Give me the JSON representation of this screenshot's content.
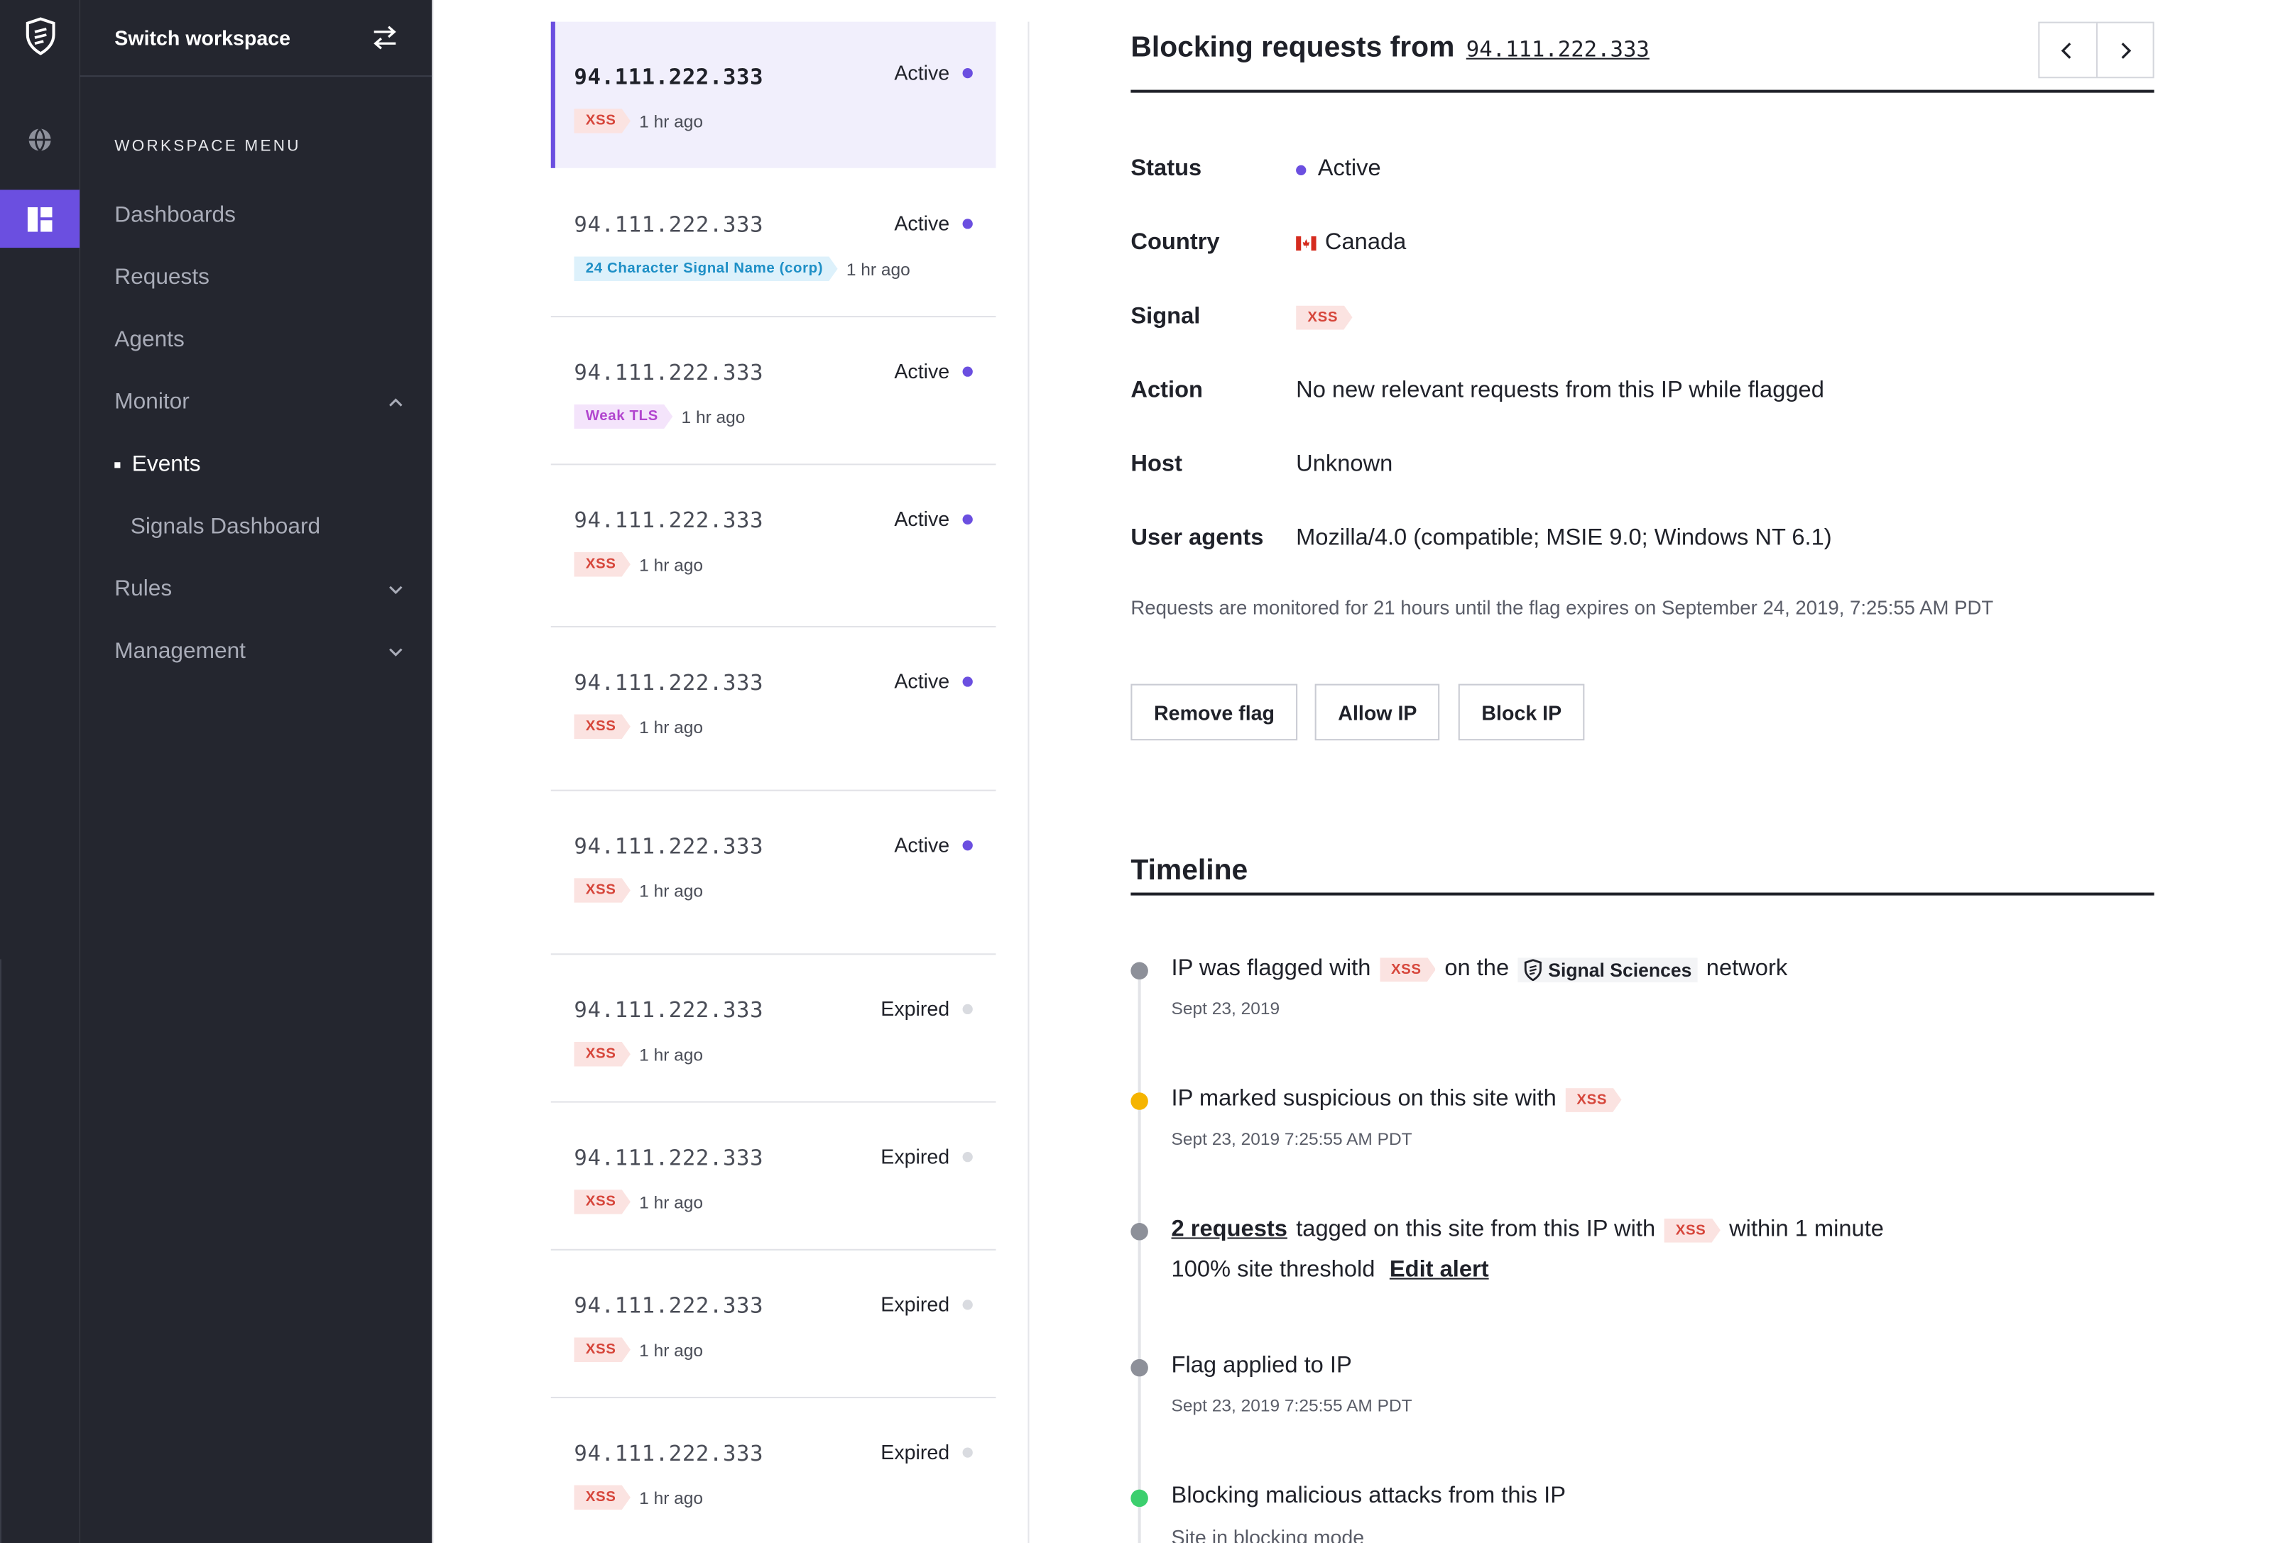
{
  "sidebar": {
    "switch_label": "Switch workspace",
    "menu_label": "WORKSPACE MENU",
    "items": [
      {
        "label": "Dashboards"
      },
      {
        "label": "Requests"
      },
      {
        "label": "Agents"
      },
      {
        "label": "Monitor"
      },
      {
        "label": "Events"
      },
      {
        "label": "Signals Dashboard"
      },
      {
        "label": "Rules"
      },
      {
        "label": "Management"
      }
    ]
  },
  "list": {
    "cards": [
      {
        "ip": "94.111.222.333",
        "state": "Active",
        "tag": "XSS",
        "time": "1 hr ago"
      },
      {
        "ip": "94.111.222.333",
        "state": "Active",
        "tag": "24 Character Signal Name (corp)",
        "time": "1 hr ago"
      },
      {
        "ip": "94.111.222.333",
        "state": "Active",
        "tag": "Weak TLS",
        "time": "1 hr ago"
      },
      {
        "ip": "94.111.222.333",
        "state": "Active",
        "tag": "XSS",
        "time": "1 hr ago"
      },
      {
        "ip": "94.111.222.333",
        "state": "Active",
        "tag": "XSS",
        "time": "1 hr ago"
      },
      {
        "ip": "94.111.222.333",
        "state": "Active",
        "tag": "XSS",
        "time": "1 hr ago"
      },
      {
        "ip": "94.111.222.333",
        "state": "Expired",
        "tag": "XSS",
        "time": "1 hr ago"
      },
      {
        "ip": "94.111.222.333",
        "state": "Expired",
        "tag": "XSS",
        "time": "1 hr ago"
      },
      {
        "ip": "94.111.222.333",
        "state": "Expired",
        "tag": "XSS",
        "time": "1 hr ago"
      },
      {
        "ip": "94.111.222.333",
        "state": "Expired",
        "tag": "XSS",
        "time": "1 hr ago"
      }
    ]
  },
  "detail": {
    "title": "Blocking requests from",
    "ip": "94.111.222.333",
    "rows": {
      "status_label": "Status",
      "status_value": "Active",
      "country_label": "Country",
      "country_value": "Canada",
      "signal_label": "Signal",
      "signal_value": "XSS",
      "action_label": "Action",
      "action_value": "No new relevant requests from this IP while flagged",
      "host_label": "Host",
      "host_value": "Unknown",
      "ua_label": "User agents",
      "ua_value": "Mozilla/4.0 (compatible; MSIE 9.0; Windows NT 6.1)"
    },
    "note": "Requests are monitored for 21 hours until the flag expires on September 24, 2019, 7:25:55 AM PDT",
    "buttons": {
      "remove": "Remove flag",
      "allow": "Allow IP",
      "block": "Block IP"
    }
  },
  "timeline": {
    "title": "Timeline",
    "items": [
      {
        "a": "IP was flagged with",
        "tag": "XSS",
        "b": "on the",
        "brand": "Signal Sciences",
        "c": "network",
        "sub": "Sept 23, 2019"
      },
      {
        "a": "IP marked suspicious on this site with",
        "tag": "XSS",
        "sub": "Sept 23, 2019 7:25:55 AM PDT"
      },
      {
        "link": "2 requests",
        "a": "tagged on this site from this IP with",
        "tag": "XSS",
        "b": "within 1 minute",
        "line2": "100% site threshold",
        "link2": "Edit alert"
      },
      {
        "a": "Flag applied to IP",
        "sub": "Sept 23, 2019 7:25:55 AM PDT"
      },
      {
        "a": "Blocking malicious attacks from this IP",
        "sub": "Site in blocking mode"
      }
    ]
  },
  "colors": {
    "accent": "#6b4fe0",
    "sidebar": "#24262f",
    "xss": "#d6463b",
    "warning": "#f5b400",
    "success": "#3ccf6e",
    "neutral": "#8d9099"
  }
}
